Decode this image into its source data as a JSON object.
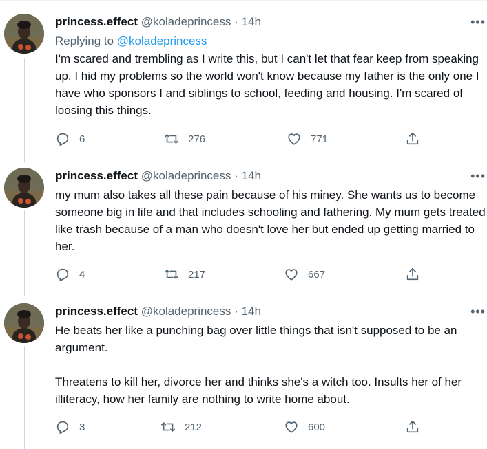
{
  "tweets": [
    {
      "name": "princess.effect",
      "handle": "@koladeprincess",
      "time": "14h",
      "replying_prefix": "Replying to",
      "replying_handle": "@koladeprincess",
      "text": "I'm scared and trembling as I write this, but I can't let that fear keep from speaking up. I hid my problems so the world won't know because my father is the only one I have who sponsors I and siblings to school, feeding and housing. I'm scared of loosing this things.",
      "replies": "6",
      "retweets": "276",
      "likes": "771"
    },
    {
      "name": "princess.effect",
      "handle": "@koladeprincess",
      "time": "14h",
      "text": "my mum also takes all these pain because of his miney. She wants us to become someone big in life and that includes schooling and fathering. My mum gets treated like trash because of a man who doesn't love her but ended up getting married to her.",
      "replies": "4",
      "retweets": "217",
      "likes": "667"
    },
    {
      "name": "princess.effect",
      "handle": "@koladeprincess",
      "time": "14h",
      "text": "He beats her like a punching bag over little things that isn't supposed to be an argument.\n\nThreatens to kill her, divorce her and thinks she's a witch too. Insults her of her illiteracy, how her family are nothing to write home about.",
      "replies": "3",
      "retweets": "212",
      "likes": "600"
    }
  ],
  "separator": "·",
  "icons": {
    "more": "more-icon",
    "reply": "reply-icon",
    "retweet": "retweet-icon",
    "like": "heart-icon",
    "share": "share-icon"
  },
  "colors": {
    "text": "#0f1419",
    "secondary": "#536471",
    "link": "#1d9bf0",
    "thread_line": "#cfd9de"
  }
}
